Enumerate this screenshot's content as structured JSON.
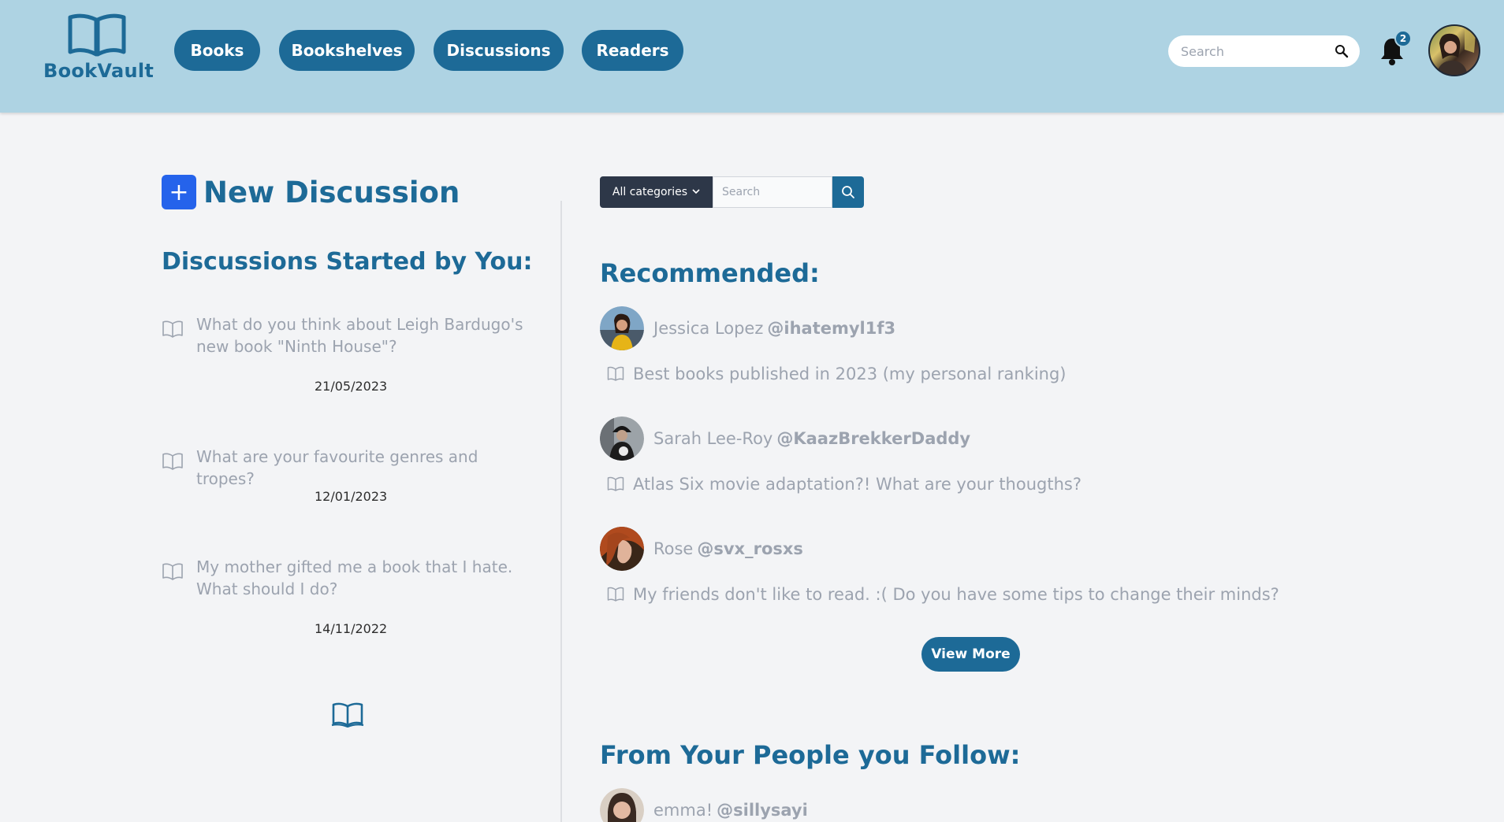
{
  "header": {
    "logo_text": "BookVault",
    "nav": [
      "Books",
      "Bookshelves",
      "Discussions",
      "Readers"
    ],
    "search_placeholder": "Search",
    "notification_count": "2"
  },
  "left": {
    "new_discussion_icon": "+",
    "new_discussion_label": "New Discussion",
    "started_title": "Discussions Started by You:",
    "discussions": [
      {
        "question": "What do you think about Leigh Bardugo's new book \"Ninth House\"?",
        "date": "21/05/2023"
      },
      {
        "question": "What are your favourite genres and tropes?",
        "date": "12/01/2023"
      },
      {
        "question": "My mother gifted me a book that I hate. What should I do?",
        "date": "14/11/2022"
      }
    ]
  },
  "right": {
    "filter": {
      "category_label": "All categories",
      "search_placeholder": "Search"
    },
    "recommended_title": "Recommended:",
    "recommended": [
      {
        "name": "Jessica Lopez",
        "handle": "@ihatemyl1f3",
        "post": "Best books published in 2023 (my personal ranking)"
      },
      {
        "name": "Sarah Lee-Roy",
        "handle": "@KaazBrekkerDaddy",
        "post": "Atlas Six movie adaptation?! What are your thougths?"
      },
      {
        "name": "Rose",
        "handle": "@svx_rosxs",
        "post": "My friends don't like to read. :( Do you have some tips to change their minds?"
      }
    ],
    "view_more": "View More",
    "following_title": "From Your People you Follow:",
    "following": [
      {
        "name": "emma!",
        "handle": "@sillysayi"
      }
    ]
  },
  "colors": {
    "brand": "#1d6a97",
    "header_bg": "#aed3e3",
    "page_bg": "#f3f4f6",
    "new_button": "#2563eb"
  },
  "icons": [
    "logo-book-icon",
    "search-icon",
    "bell-icon",
    "book-icon",
    "chevron-down-icon",
    "plus-icon"
  ]
}
